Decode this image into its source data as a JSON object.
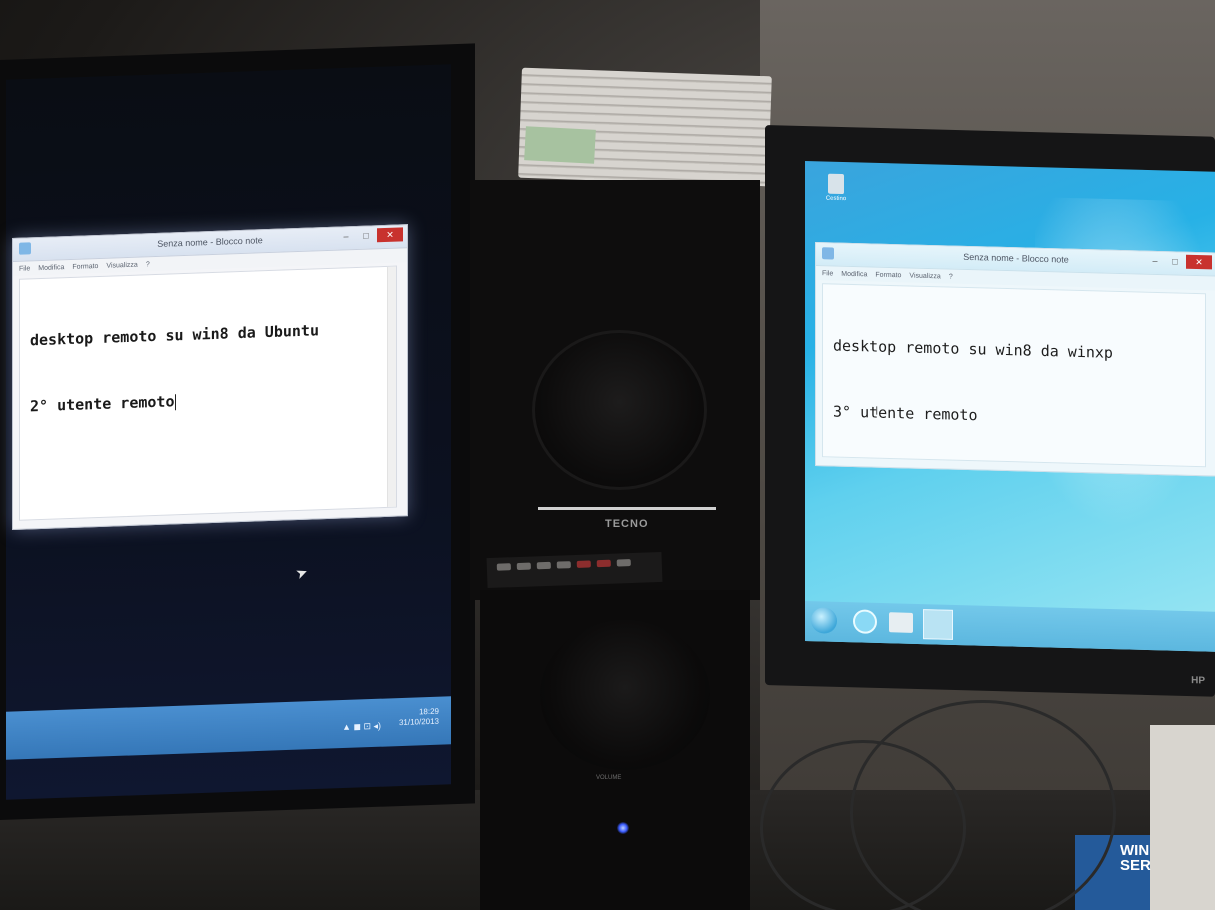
{
  "left_monitor": {
    "notepad": {
      "title": "Senza nome - Blocco note",
      "menu": [
        "File",
        "Modifica",
        "Formato",
        "Visualizza",
        "?"
      ],
      "text_lines": [
        "desktop remoto su win8 da Ubuntu",
        "2° utente remoto"
      ]
    },
    "tray": {
      "time": "18:29",
      "date": "31/10/2013",
      "icons": "▲ ◼ ⊡ ◂)"
    }
  },
  "speaker": {
    "brand": "TECNO",
    "label": "VOLUME"
  },
  "right_monitor": {
    "desktop_icon": "Cestino",
    "notepad": {
      "title": "Senza nome - Blocco note",
      "menu": [
        "File",
        "Modifica",
        "Formato",
        "Visualizza",
        "?"
      ],
      "text_lines": [
        "desktop remoto su win8 da winxp",
        "3° utente remoto"
      ]
    },
    "brand": "HP"
  },
  "box": {
    "text": "WIN SER"
  },
  "colors": {
    "left_taskbar": "#3a7fc2",
    "right_wallpaper": "#2fb0e4",
    "close_button": "#c8322e",
    "power_led": "#3a5bff"
  }
}
